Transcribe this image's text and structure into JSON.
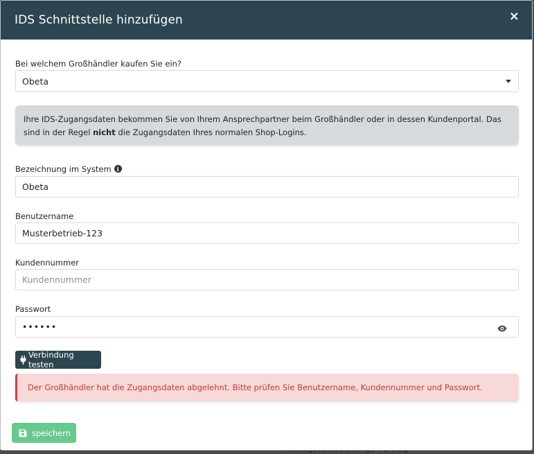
{
  "backdrop": {
    "text": "Auftragsverarbeitungs-Vertrag"
  },
  "modal": {
    "title": "IDS Schnittstelle hinzufügen",
    "close_label": "×"
  },
  "wholesaler": {
    "label": "Bei welchem Großhändler kaufen Sie ein?",
    "selected": "Obeta"
  },
  "info": {
    "text_before": "Ihre IDS-Zugangsdaten bekommen Sie von Ihrem Ansprechpartner beim Großhändler oder in dessen Kundenportal. Das sind in der Regel ",
    "text_bold": "nicht",
    "text_after": " die Zugangsdaten Ihres normalen Shop-Logins."
  },
  "system_name": {
    "label": "Bezeichnung im System",
    "value": "Obeta"
  },
  "username": {
    "label": "Benutzername",
    "value": "Musterbetrieb-123"
  },
  "customer_number": {
    "label": "Kundennummer",
    "placeholder": "Kundennummer",
    "value": ""
  },
  "password": {
    "label": "Passwort",
    "value": "••••••"
  },
  "test_button": {
    "label": "Verbindung testen"
  },
  "error": {
    "text": "Der Großhändler hat die Zugangsdaten abgelehnt. Bitte prüfen Sie Benutzername, Kundennummer und Passwort."
  },
  "save_button": {
    "label": "speichern"
  },
  "colors": {
    "header_bg": "#2d4550",
    "info_bg": "#d6dadc",
    "error_bg": "#f8d9d9",
    "error_text": "#c23a3a",
    "save_bg": "#69c88e"
  }
}
